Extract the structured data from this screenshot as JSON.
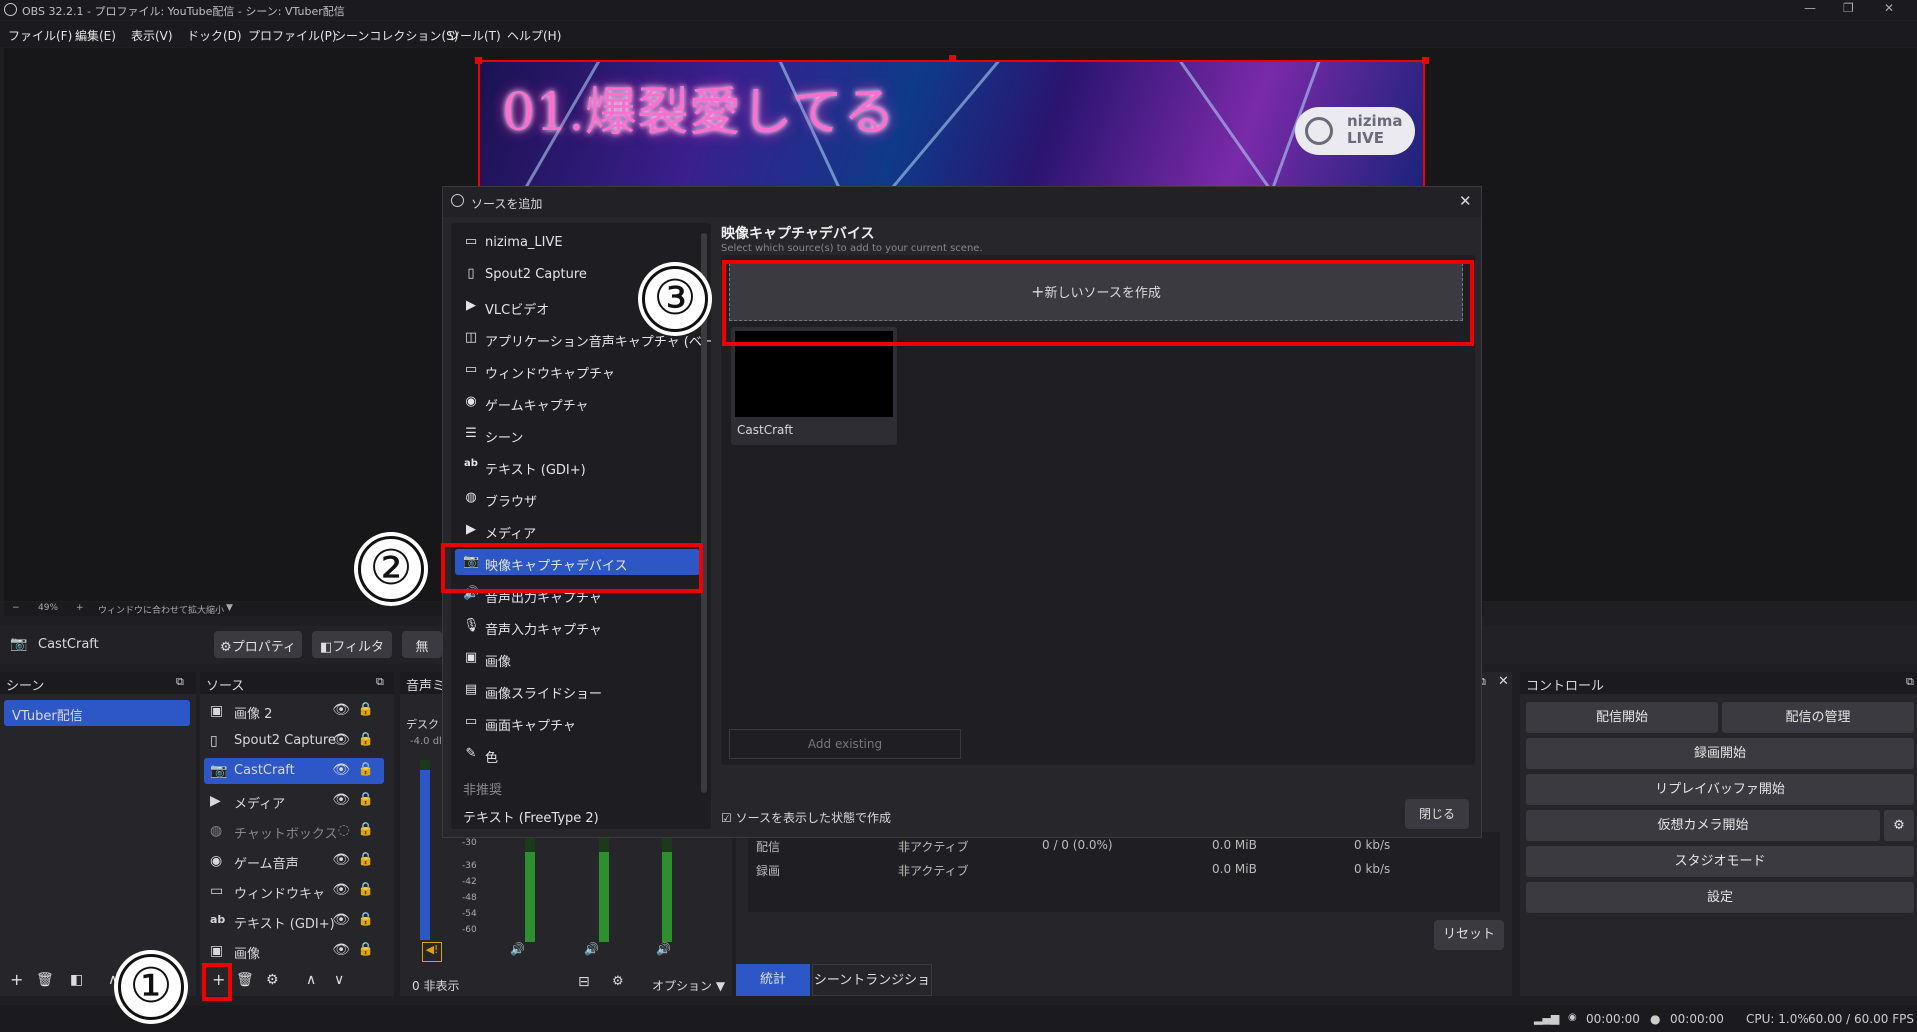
{
  "window": {
    "title": "OBS 32.2.1 - プロファイル: YouTube配信 - シーン: VTuber配信",
    "min": "—",
    "max": "❐",
    "close": "✕"
  },
  "menu": [
    "ファイル(F)",
    "編集(E)",
    "表示(V)",
    "ドック(D)",
    "プロファイル(P)",
    "シーンコレクション(S)",
    "ツール(T)",
    "ヘルプ(H)"
  ],
  "preview": {
    "song_title": "01.爆裂愛してる",
    "logo_line1": "nizima",
    "logo_line2": "LIVE",
    "zoom": "49%",
    "fit_label": "ウィンドウに合わせて拡大縮小"
  },
  "source_toolbar": {
    "selected_source": "CastCraft",
    "properties": "プロパティ",
    "filters": "フィルタ",
    "deactivate": "無"
  },
  "scenes": {
    "header": "シーン",
    "items": [
      "VTuber配信"
    ]
  },
  "sources": {
    "header": "ソース",
    "items": [
      {
        "label": "画像 2",
        "icon": "image-icon"
      },
      {
        "label": "Spout2 Capture",
        "icon": "file-icon"
      },
      {
        "label": "CastCraft",
        "icon": "camera-icon"
      },
      {
        "label": "メディア",
        "icon": "play-icon"
      },
      {
        "label": "チャットボックス",
        "icon": "globe-icon"
      },
      {
        "label": "ゲーム音声",
        "icon": "gamepad-icon"
      },
      {
        "label": "ウィンドウキャプチャ",
        "icon": "window-icon"
      },
      {
        "label": "テキスト (GDI+)",
        "icon": "text-icon"
      },
      {
        "label": "画像",
        "icon": "image-icon"
      }
    ]
  },
  "mixer": {
    "header": "音声ミ",
    "track1": "デスクト",
    "level": "-4.0 dl",
    "hidden": "0 非表示",
    "options": "オプション",
    "scale": [
      "-36",
      "-42",
      "-48",
      "-54",
      "-60"
    ],
    "scale_top": "-30"
  },
  "stats": {
    "rows": [
      {
        "name": "配信",
        "state": "非アクティブ",
        "frames": "0 / 0 (0.0%)",
        "size": "0.0 MiB",
        "rate": "0 kb/s"
      },
      {
        "name": "録画",
        "state": "非アクティブ",
        "frames": "",
        "size": "0.0 MiB",
        "rate": "0 kb/s"
      }
    ],
    "reset": "リセット",
    "tab_stats": "統計",
    "tab_transition": "シーントランジション"
  },
  "controls": {
    "header": "コントロール",
    "start_stream": "配信開始",
    "manage_stream": "配信の管理",
    "start_record": "録画開始",
    "replay_buffer": "リプレイバッファ開始",
    "virtual_cam": "仮想カメラ開始",
    "studio_mode": "スタジオモード",
    "settings": "設定"
  },
  "status_bar": {
    "stream_time": "00:00:00",
    "record_time": "00:00:00",
    "cpu": "CPU: 1.0%",
    "fps": "60.00 / 60.00 FPS"
  },
  "dialog": {
    "title": "ソースを追加",
    "list": [
      {
        "label": "nizima_LIVE",
        "icon": "window-icon"
      },
      {
        "label": "Spout2 Capture",
        "icon": "file-icon"
      },
      {
        "label": "VLCビデオ",
        "icon": "play-icon"
      },
      {
        "label": "アプリケーション音声キャプチャ (ベータ版)",
        "icon": "app-audio-icon"
      },
      {
        "label": "ウィンドウキャプチャ",
        "icon": "window-icon"
      },
      {
        "label": "ゲームキャプチャ",
        "icon": "gamepad-icon"
      },
      {
        "label": "シーン",
        "icon": "list-icon"
      },
      {
        "label": "テキスト (GDI+)",
        "icon": "text-icon"
      },
      {
        "label": "ブラウザ",
        "icon": "globe-icon"
      },
      {
        "label": "メディア",
        "icon": "play-icon"
      },
      {
        "label": "映像キャプチャデバイス",
        "icon": "camera-icon"
      },
      {
        "label": "音声出力キャプチャ",
        "icon": "speaker-icon"
      },
      {
        "label": "音声入力キャプチャ",
        "icon": "mic-icon"
      },
      {
        "label": "画像",
        "icon": "image-icon"
      },
      {
        "label": "画像スライドショー",
        "icon": "slideshow-icon"
      },
      {
        "label": "画面キャプチャ",
        "icon": "monitor-icon"
      },
      {
        "label": "色",
        "icon": "brush-icon"
      }
    ],
    "deprecated_header": "非推奨",
    "deprecated_item": "テキスト (FreeType 2)",
    "heading": "映像キャプチャデバイス",
    "subheading": "Select which source(s) to add to your current scene.",
    "create_new": "新しいソースを作成",
    "existing_source": "CastCraft",
    "add_existing": "Add existing",
    "visible_checkbox": "ソースを表示した状態で作成",
    "close": "閉じる"
  },
  "callouts": [
    "①",
    "②",
    "③"
  ]
}
